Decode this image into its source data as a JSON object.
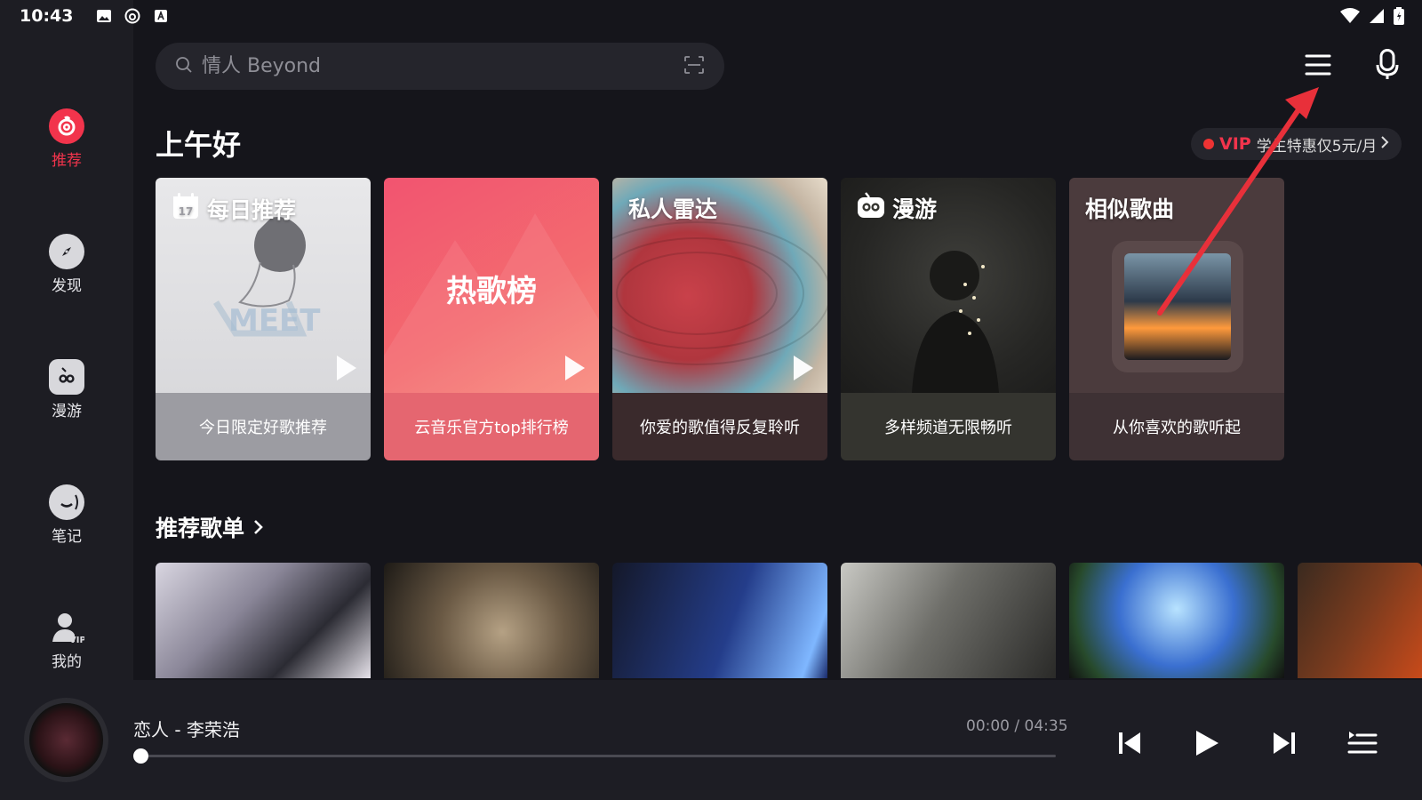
{
  "status_bar": {
    "time": "10:43"
  },
  "search": {
    "placeholder": "情人 Beyond"
  },
  "sidebar": {
    "items": [
      {
        "label": "推荐",
        "icon": "netease-music-icon",
        "active": true
      },
      {
        "label": "发现",
        "icon": "compass-icon",
        "active": false
      },
      {
        "label": "漫游",
        "icon": "radio-icon",
        "active": false
      },
      {
        "label": "笔记",
        "icon": "note-icon",
        "active": false
      },
      {
        "label": "我的",
        "icon": "vip-user-icon",
        "active": false
      }
    ]
  },
  "greeting": "上午好",
  "vip_banner": {
    "tag": "VIP",
    "text": "学生特惠仅5元/月"
  },
  "feature_cards": [
    {
      "title": "每日推荐",
      "center": "",
      "subtitle": "今日限定好歌推荐",
      "icon": "calendar-icon",
      "day": "17"
    },
    {
      "title": "",
      "center": "热歌榜",
      "subtitle": "云音乐官方top排行榜",
      "icon": ""
    },
    {
      "title": "私人雷达",
      "center": "",
      "subtitle": "你爱的歌值得反复聆听",
      "icon": ""
    },
    {
      "title": "漫游",
      "center": "",
      "subtitle": "多样频道无限畅听",
      "icon": "radio-icon"
    },
    {
      "title": "相似歌曲",
      "center": "",
      "subtitle": "从你喜欢的歌听起",
      "icon": ""
    }
  ],
  "playlist_section": {
    "title": "推荐歌单"
  },
  "player": {
    "song": "恋人 - 李荣浩",
    "time": "00:00 / 04:35",
    "progress": 0.0
  },
  "colors": {
    "accent": "#f2344c",
    "background": "#15151b",
    "sidebar": "#1d1d23",
    "annotation_arrow": "#e8303a"
  }
}
